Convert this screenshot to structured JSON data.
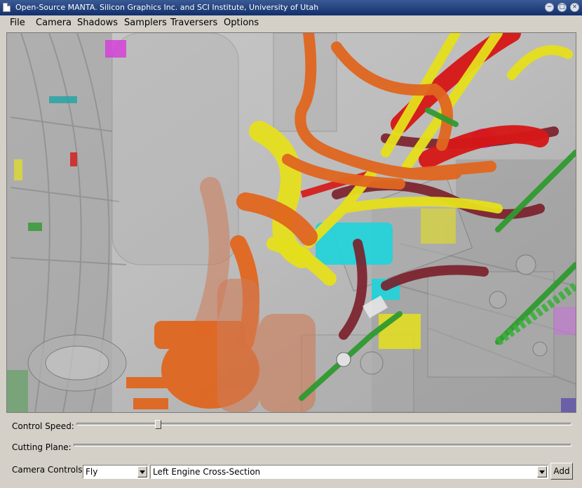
{
  "window": {
    "title": "Open-Source MANTA. Silicon Graphics Inc. and SCI Institute, University of Utah",
    "app_icon": "document-icon",
    "controls": {
      "minimize_glyph": "−",
      "maximize_glyph": "□",
      "close_glyph": "×"
    }
  },
  "menu": {
    "items": [
      {
        "label": "File"
      },
      {
        "label": "Camera"
      },
      {
        "label": "Shadows"
      },
      {
        "label": "Samplers"
      },
      {
        "label": "Traversers"
      },
      {
        "label": "Options"
      }
    ]
  },
  "viewport": {
    "content": "ray-traced-engine-cross-section",
    "part_colors": {
      "orange": "#e0661f",
      "yellow": "#e5df1c",
      "red": "#d61616",
      "dark_red": "#7a1f2a",
      "green": "#2f9a2f",
      "cyan": "#1fd4dc",
      "magenta": "#d43ad8",
      "gray": "#b4b4b4"
    }
  },
  "controls": {
    "control_speed": {
      "label": "Control Speed:",
      "value_fraction": 0.16
    },
    "cutting_plane": {
      "label": "Cutting Plane:"
    },
    "camera_controls": {
      "label": "Camera Controls:",
      "mode": "Fly",
      "bookmark": "Left Engine Cross-Section",
      "add_label": "Add"
    }
  },
  "colors": {
    "title_bar": "#1b3a78",
    "window_bg": "#d4d0c8"
  }
}
